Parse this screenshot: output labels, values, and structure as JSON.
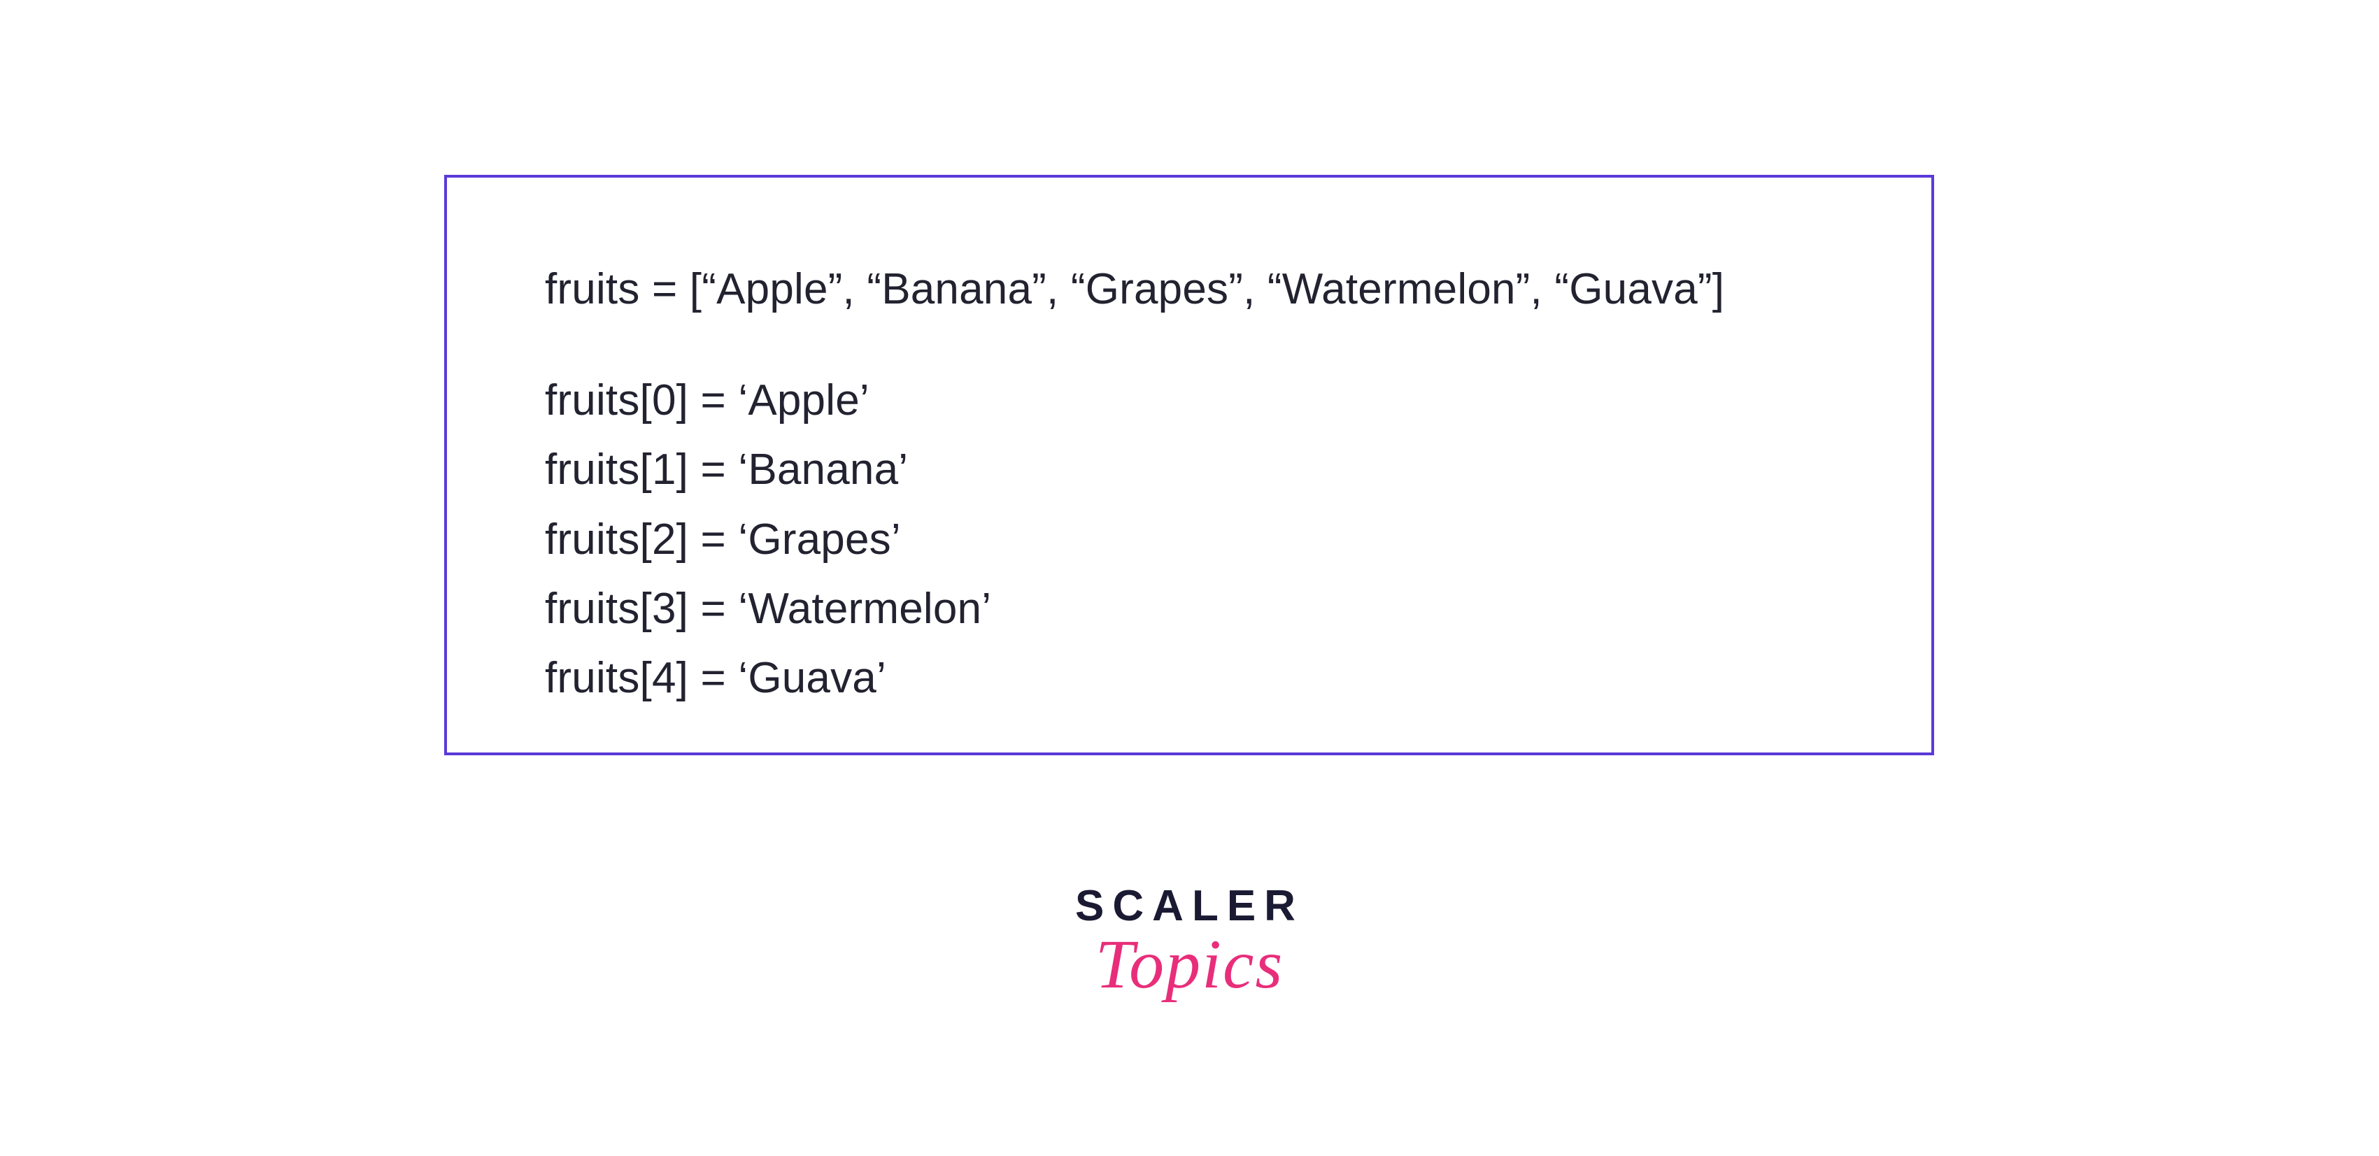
{
  "code": {
    "declaration": "fruits = [“Apple”, “Banana”, “Grapes”, “Watermelon”, “Guava”]",
    "lines": [
      "fruits[0] = ‘Apple’",
      "fruits[1] = ‘Banana’",
      "fruits[2] = ‘Grapes’",
      "fruits[3] = ‘Watermelon’",
      "fruits[4] = ‘Guava’"
    ]
  },
  "logo": {
    "line1": "SCALER",
    "line2": "Topics"
  }
}
